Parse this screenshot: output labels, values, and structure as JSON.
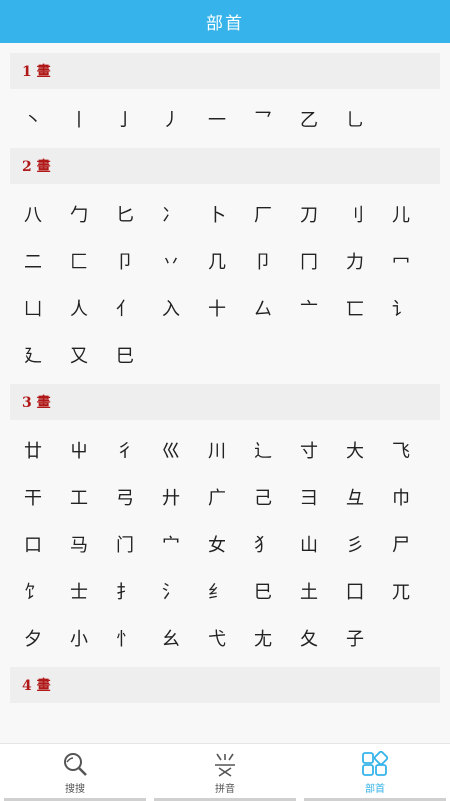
{
  "header": {
    "title": "部首"
  },
  "sections": [
    {
      "title": "1 畫",
      "chars": [
        "丶",
        "丨",
        "亅",
        "丿",
        "一",
        "乛",
        "乙",
        "乚"
      ]
    },
    {
      "title": "2 畫",
      "chars": [
        "八",
        "勹",
        "匕",
        "冫",
        "卜",
        "厂",
        "刀",
        "刂",
        "儿",
        "二",
        "匚",
        "卩",
        "丷",
        "几",
        "卩",
        "冂",
        "力",
        "冖",
        "凵",
        "人",
        "亻",
        "入",
        "十",
        "厶",
        "亠",
        "匸",
        "讠",
        "廴",
        "又",
        "巳"
      ]
    },
    {
      "title": "3 畫",
      "chars": [
        "廿",
        "屮",
        "彳",
        "巛",
        "川",
        "辶",
        "寸",
        "大",
        "飞",
        "干",
        "工",
        "弓",
        "廾",
        "广",
        "己",
        "彐",
        "彑",
        "巾",
        "口",
        "马",
        "门",
        "宀",
        "女",
        "犭",
        "山",
        "彡",
        "尸",
        "饣",
        "士",
        "扌",
        "氵",
        "纟",
        "巳",
        "土",
        "囗",
        "兀",
        "夕",
        "小",
        "忄",
        "幺",
        "弋",
        "尢",
        "夂",
        "子"
      ]
    },
    {
      "title": "4 畫",
      "chars": []
    }
  ],
  "tabs": [
    {
      "label": "搜搜",
      "icon": "search-icon"
    },
    {
      "label": "拼音",
      "icon": "pinyin-icon"
    },
    {
      "label": "部首",
      "icon": "radical-grid-icon"
    }
  ],
  "colors": {
    "accent": "#35b3ea",
    "section_title": "#b01818"
  }
}
